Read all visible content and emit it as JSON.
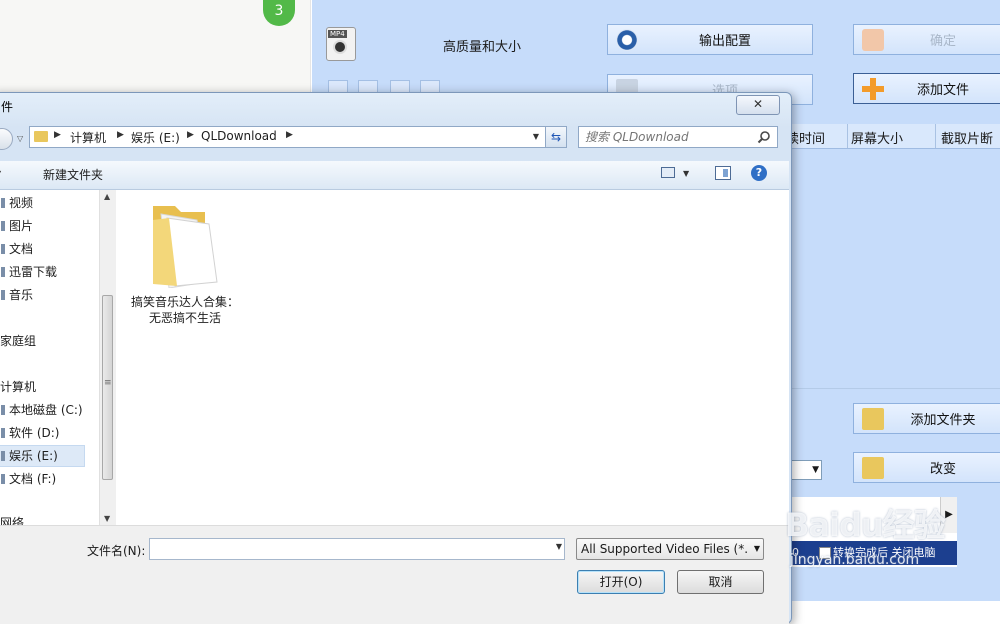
{
  "background_app": {
    "step_number": "3",
    "quality_label": "高质量和大小",
    "output_config_label": "输出配置",
    "options_label": "选项",
    "confirm_label": "确定",
    "add_file_label": "添加文件",
    "add_folder_label": "添加文件夹",
    "change_label": "改变",
    "columns": [
      "续时间",
      "屏幕大小",
      "截取片断"
    ],
    "combo_value": "",
    "status_left": "00",
    "status_after_convert": "转换完成后",
    "status_shutdown": "关闭电脑",
    "accent_color": "#c6dcfa"
  },
  "dialog": {
    "title": "件",
    "close_glyph": "✕",
    "address": {
      "crumbs": [
        "计算机",
        "娱乐 (E:)",
        "QLDownload"
      ]
    },
    "search": {
      "placeholder": "搜索 QLDownload"
    },
    "toolbar": {
      "new_folder_label": "新建文件夹",
      "help_glyph": "?"
    },
    "nav_items": [
      {
        "label": "视频"
      },
      {
        "label": "图片"
      },
      {
        "label": "文档"
      },
      {
        "label": "迅雷下载"
      },
      {
        "label": "音乐"
      },
      {
        "label": "家庭组"
      },
      {
        "label": "计算机"
      },
      {
        "label": "本地磁盘 (C:)"
      },
      {
        "label": "软件 (D:)"
      },
      {
        "label": "娱乐 (E:)",
        "selected": true
      },
      {
        "label": "文档 (F:)"
      },
      {
        "label": "网络"
      }
    ],
    "files": [
      {
        "name": "搞笑音乐达人合集：无恶搞不生活",
        "icon": "folder-icon"
      }
    ],
    "filename_label": "文件名(N):",
    "filename_value": "",
    "filetype_value": "All Supported Video Files (*.",
    "open_label": "打开(O)",
    "cancel_label": "取消"
  },
  "watermark": {
    "logo": "Baidu经验",
    "url": "jingyan.baidu.com"
  }
}
